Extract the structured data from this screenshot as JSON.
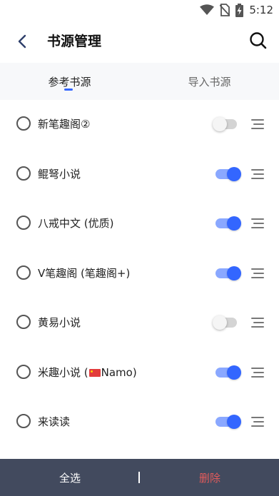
{
  "status_bar": {
    "time": "5:12",
    "icons": [
      "wifi-icon",
      "no-sim-icon",
      "battery-charging-icon"
    ]
  },
  "header": {
    "title": "书源管理",
    "back_icon": "chevron-left-icon",
    "search_icon": "search-icon"
  },
  "tabs": [
    {
      "label": "参考书源",
      "active": true
    },
    {
      "label": "导入书源",
      "active": false
    }
  ],
  "sources": [
    {
      "pre": "新笔趣阁②",
      "post": "",
      "flag": false,
      "enabled": false
    },
    {
      "pre": "鲲弩小说",
      "post": "",
      "flag": false,
      "enabled": true
    },
    {
      "pre": "八戒中文 (优质)",
      "post": "",
      "flag": false,
      "enabled": true
    },
    {
      "pre": "V笔趣阁 (笔趣阁+)",
      "post": "",
      "flag": false,
      "enabled": true
    },
    {
      "pre": "黄易小说",
      "post": "",
      "flag": false,
      "enabled": false
    },
    {
      "pre": "米趣小说 (",
      "post": "Namo)",
      "flag": true,
      "enabled": true
    },
    {
      "pre": "来读读",
      "post": "",
      "flag": false,
      "enabled": true
    }
  ],
  "bottom_bar": {
    "select_all": "全选",
    "delete": "删除"
  },
  "colors": {
    "accent": "#3366ff",
    "bottom_bar": "#424a5e",
    "delete": "#e25b5b"
  }
}
